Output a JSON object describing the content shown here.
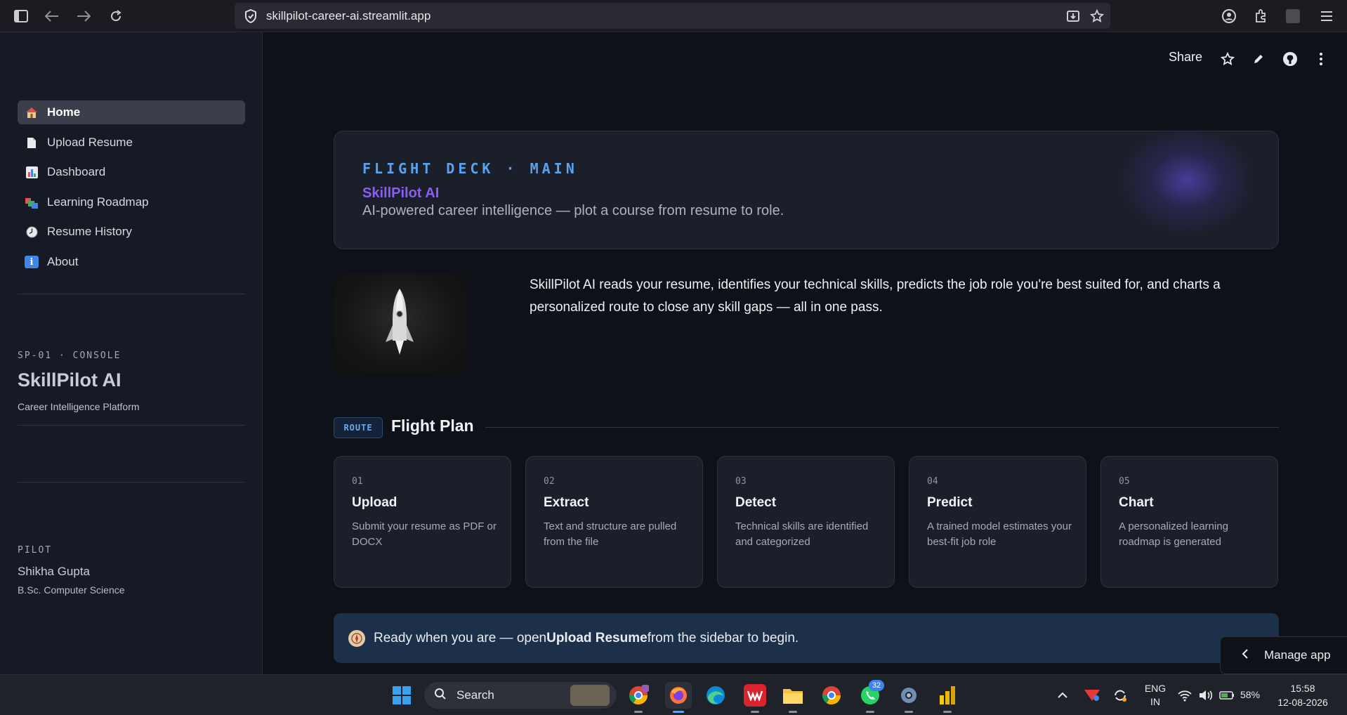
{
  "browser": {
    "url": "skillpilot-career-ai.streamlit.app"
  },
  "sidebar": {
    "items": [
      {
        "label": "Home",
        "icon": "house-icon",
        "active": true
      },
      {
        "label": "Upload Resume",
        "icon": "page-icon"
      },
      {
        "label": "Dashboard",
        "icon": "bar-chart-icon"
      },
      {
        "label": "Learning Roadmap",
        "icon": "books-icon"
      },
      {
        "label": "Resume History",
        "icon": "clock-icon"
      },
      {
        "label": "About",
        "icon": "info-icon"
      }
    ],
    "console_tag": "SP-01 · CONSOLE",
    "console_title": "SkillPilot AI",
    "console_sub": "Career Intelligence Platform",
    "pilot_tag": "PILOT",
    "pilot_name": "Shikha Gupta",
    "pilot_degree": "B.Sc. Computer Science"
  },
  "header": {
    "share_label": "Share"
  },
  "hero": {
    "kicker": "FLIGHT DECK · MAIN",
    "brand": "SkillPilot AI",
    "tagline": "AI-powered career intelligence — plot a course from resume to role."
  },
  "intro": {
    "text": "SkillPilot AI reads your resume, identifies your technical skills, predicts the job role you're best suited for, and charts a personalized route to close any skill gaps — all in one pass."
  },
  "flight_plan": {
    "badge": "ROUTE",
    "title": "Flight Plan",
    "steps": [
      {
        "num": "01",
        "title": "Upload",
        "desc": "Submit your resume as PDF or DOCX"
      },
      {
        "num": "02",
        "title": "Extract",
        "desc": "Text and structure are pulled from the file"
      },
      {
        "num": "03",
        "title": "Detect",
        "desc": "Technical skills are identified and categorized"
      },
      {
        "num": "04",
        "title": "Predict",
        "desc": "A trained model estimates your best-fit job role"
      },
      {
        "num": "05",
        "title": "Chart",
        "desc": "A personalized learning roadmap is generated"
      }
    ]
  },
  "notice": {
    "before": "Ready when you are — open ",
    "bold": "Upload Resume",
    "after": " from the sidebar to begin."
  },
  "manage_app": {
    "label": "Manage app"
  },
  "taskbar": {
    "search_label": "Search",
    "whatsapp_badge": "32",
    "lang_top": "ENG",
    "lang_bottom": "IN",
    "battery": "58%",
    "time": "15:58",
    "date": "12-08-2026"
  },
  "colors": {
    "accent_blue": "#5aa2f0",
    "brand_purple": "#8b5cf6",
    "background": "#0e1117",
    "card": "#1b1f29"
  }
}
